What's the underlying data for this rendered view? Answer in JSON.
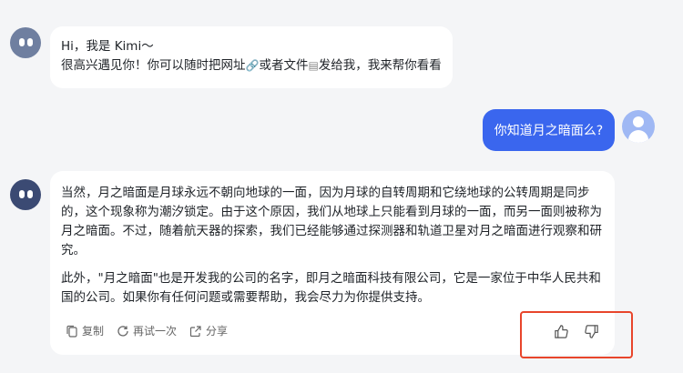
{
  "greeting": {
    "line1": "Hi，我是 Kimi～",
    "line2_a": "很高兴遇见你！你可以随时把网址",
    "line2_b": "或者文件",
    "line2_c": "发给我，我来帮你看看",
    "link_icon": "🔗",
    "file_icon": "▤"
  },
  "user_message": {
    "text": "你知道月之暗面么?"
  },
  "answer": {
    "paragraph1": "当然，月之暗面是月球永远不朝向地球的一面，因为月球的自转周期和它绕地球的公转周期是同步的，这个现象称为潮汐锁定。由于这个原因，我们从地球上只能看到月球的一面，而另一面则被称为月之暗面。不过，随着航天器的探索，我们已经能够通过探测器和轨道卫星对月之暗面进行观察和研究。",
    "paragraph2": "此外，\"月之暗面\"也是开发我的公司的名字，即月之暗面科技有限公司，它是一家位于中华人民共和国的公司。如果你有任何问题或需要帮助，我会尽力为你提供支持。"
  },
  "actions": {
    "copy": "复制",
    "retry": "再试一次",
    "share": "分享"
  },
  "colors": {
    "accent": "#3a66ee",
    "highlight": "#e8452b"
  }
}
